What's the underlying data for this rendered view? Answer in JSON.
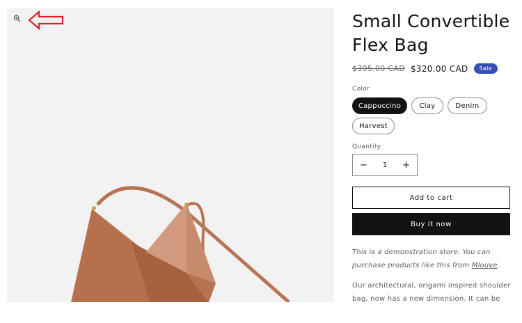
{
  "product": {
    "title": "Small Convertible Flex Bag",
    "price_original": "$395.00 CAD",
    "price_sale": "$320.00 CAD",
    "sale_badge": "Sale"
  },
  "color": {
    "label": "Color",
    "options": [
      "Cappuccino",
      "Clay",
      "Denim",
      "Harvest"
    ],
    "selected": "Cappuccino"
  },
  "quantity": {
    "label": "Quantity",
    "value": "1",
    "minus": "−",
    "plus": "+"
  },
  "buttons": {
    "add_to_cart": "Add to cart",
    "buy_now": "Buy it now"
  },
  "demo_note": {
    "text": "This is a demonstration store. You can purchase products like this from ",
    "link": "Mlouye",
    "suffix": "."
  },
  "description": "Our architectural, origami inspired shoulder bag, now has a new dimension. It can be",
  "icons": {
    "zoom": "zoom-in-icon",
    "annotation": "red-arrow-annotation"
  },
  "colors": {
    "bag_main": "#b8714e",
    "bag_light": "#c98f72",
    "sale_badge": "#334fb4",
    "annotation_red": "#d9232a"
  }
}
